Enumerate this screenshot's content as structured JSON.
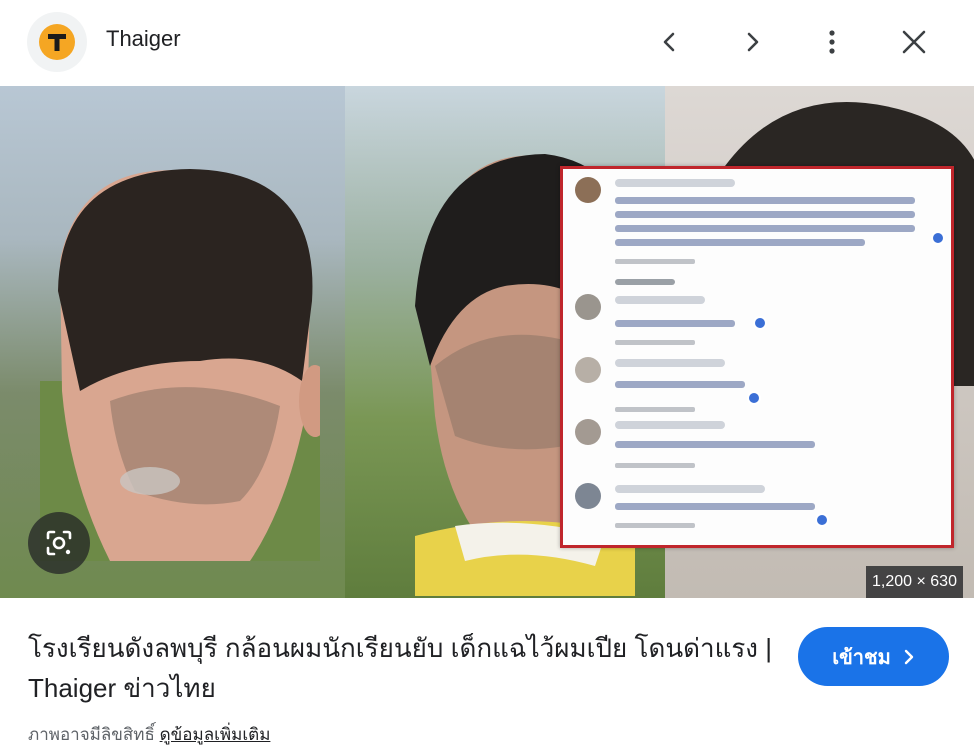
{
  "header": {
    "source_name": "Thaiger"
  },
  "image": {
    "dimensions": "1,200 × 630"
  },
  "result": {
    "title": "โรงเรียนดังลพบุรี กล้อนผมนักเรียนยับ เด็กแฉไว้ผมเปีย โดนด่าแรง | Thaiger ข่าวไทย",
    "visit_label": "เข้าชม",
    "copyright_notice": "ภาพอาจมีลิขสิทธิ์",
    "learn_more": "ดูข้อมูลเพิ่มเติม"
  },
  "colors": {
    "accent": "#1a73e8",
    "logo": "#f5a623",
    "comment_border": "#c0262c"
  },
  "icons": [
    "thaiger-logo",
    "chevron-left-icon",
    "chevron-right-icon",
    "more-vert-icon",
    "close-icon",
    "lens-icon",
    "chevron-right-small-icon"
  ]
}
